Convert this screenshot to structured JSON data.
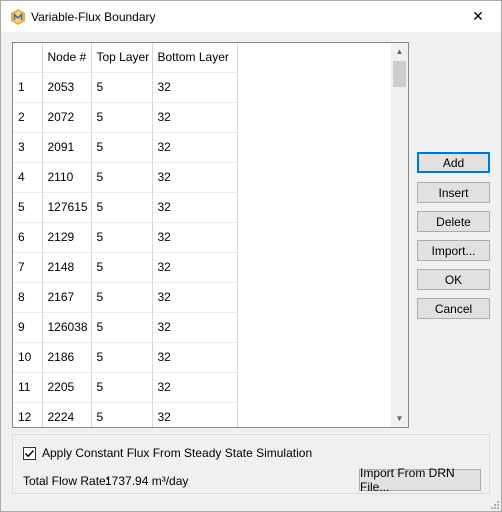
{
  "window": {
    "title": "Variable-Flux Boundary",
    "close_glyph": "✕"
  },
  "grid": {
    "columns": [
      "",
      "Node #",
      "Top Layer",
      "Bottom Layer"
    ],
    "rows": [
      {
        "n": "1",
        "node": "2053",
        "top": "5",
        "bottom": "32"
      },
      {
        "n": "2",
        "node": "2072",
        "top": "5",
        "bottom": "32"
      },
      {
        "n": "3",
        "node": "2091",
        "top": "5",
        "bottom": "32"
      },
      {
        "n": "4",
        "node": "2110",
        "top": "5",
        "bottom": "32"
      },
      {
        "n": "5",
        "node": "127615",
        "top": "5",
        "bottom": "32"
      },
      {
        "n": "6",
        "node": "2129",
        "top": "5",
        "bottom": "32"
      },
      {
        "n": "7",
        "node": "2148",
        "top": "5",
        "bottom": "32"
      },
      {
        "n": "8",
        "node": "2167",
        "top": "5",
        "bottom": "32"
      },
      {
        "n": "9",
        "node": "126038",
        "top": "5",
        "bottom": "32"
      },
      {
        "n": "10",
        "node": "2186",
        "top": "5",
        "bottom": "32"
      },
      {
        "n": "11",
        "node": "2205",
        "top": "5",
        "bottom": "32"
      },
      {
        "n": "12",
        "node": "2224",
        "top": "5",
        "bottom": "32"
      }
    ],
    "scroll_up_glyph": "▲",
    "scroll_down_glyph": "▼"
  },
  "buttons": {
    "add": "Add",
    "insert": "Insert",
    "delete": "Delete",
    "import": "Import...",
    "ok": "OK",
    "cancel": "Cancel"
  },
  "footer": {
    "apply_checkbox_label": "Apply Constant Flux From Steady State Simulation",
    "apply_checked": true,
    "flow_label": "Total Flow Rate:",
    "flow_value": "1737.94 m³/day",
    "import_drn_label": "Import From DRN File..."
  },
  "colors": {
    "accent": "#0078d7",
    "window_bg": "#f0f0f0",
    "button_bg": "#e1e1e1"
  },
  "icons": {
    "app": "mesh-app-icon",
    "close": "close-icon",
    "check": "check-icon",
    "grip": "resize-grip-icon"
  }
}
